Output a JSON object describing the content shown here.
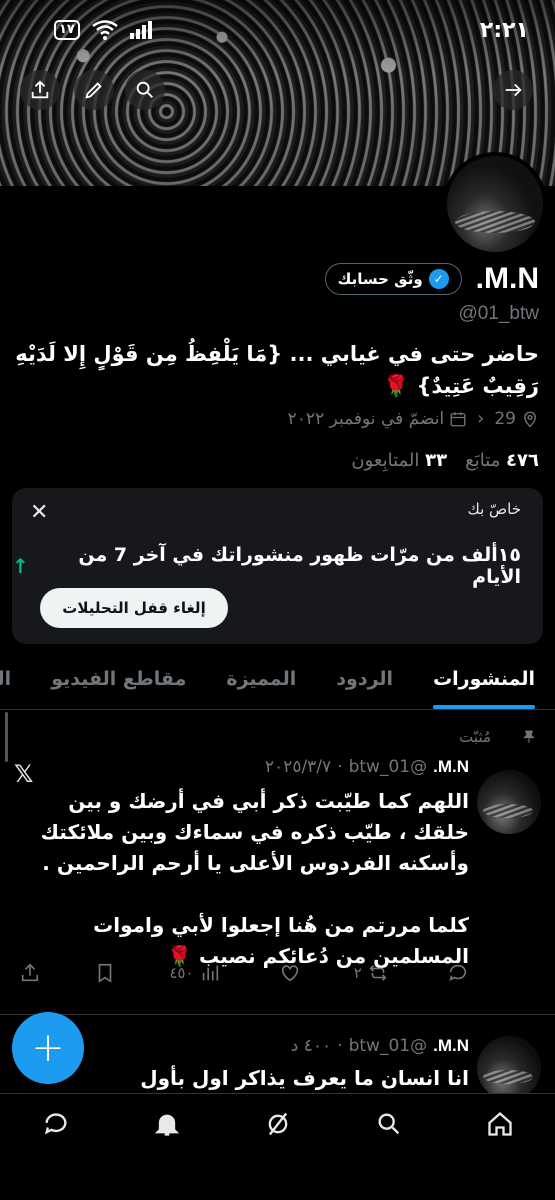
{
  "status_bar": {
    "time": "٢:٢١",
    "battery": "١٧"
  },
  "banner_buttons": [
    "back-arrow-icon",
    "search-icon",
    "edit-icon",
    "share-icon"
  ],
  "profile": {
    "name": "M.N.",
    "verify_label": "وثّق حسابك",
    "handle": "@01_btw",
    "bio": "حاضر حتى في غيابي ... {مَا يَلْفِظُ مِن قَوْلٍ إِلا لَدَيْهِ رَقِيبٌ عَتِيدٌ} 🌹",
    "location": "29",
    "joined": "انضمّ في نوفمبر ٢٠٢٢",
    "following_count": "٤٧٦",
    "following_label": "متابَع",
    "followers_count": "٣٣",
    "followers_label": "المتابِعون"
  },
  "analytics_card": {
    "title": "خاصّ بك",
    "stat_text": "١٥ألف من مرّات ظهور منشوراتك في آخر 7 من الأيام",
    "button_label": "إلغاء قفل التحليلات",
    "accent_color": "#00ba7c"
  },
  "tabs": [
    "المنشورات",
    "الردود",
    "المميزة",
    "مقاطع الفيديو",
    "الصور"
  ],
  "posts": [
    {
      "pinned_label": "مُثبّت",
      "name": "M.N.",
      "handle": "@01_btw",
      "sep": "·",
      "date": "٢٠٢٥/٣/٧",
      "text": "اللهم كما طيّبت ذكر أبي في أرضك و بين خلقك ، طيّب ذكره في سماءك وبين ملائكتك وأسكنه الفردوس الأعلى يا أرحم الراحمين .\n\nكلما مررتم من هُنا إجعلوا لأبي واموات المسلمين من دُعائكم نصيب 🌹",
      "replies": "",
      "reposts": "٢",
      "likes": "",
      "views": "٤٥٠"
    },
    {
      "name": "M.N.",
      "handle": "@01_btw",
      "sep": "·",
      "date": "٤٠٠ د",
      "text": "انا انسان ما يعرف يذاكر اول بأول"
    }
  ],
  "fab_label": "+",
  "colors": {
    "accent": "#1d9bf0",
    "background": "#000000"
  }
}
